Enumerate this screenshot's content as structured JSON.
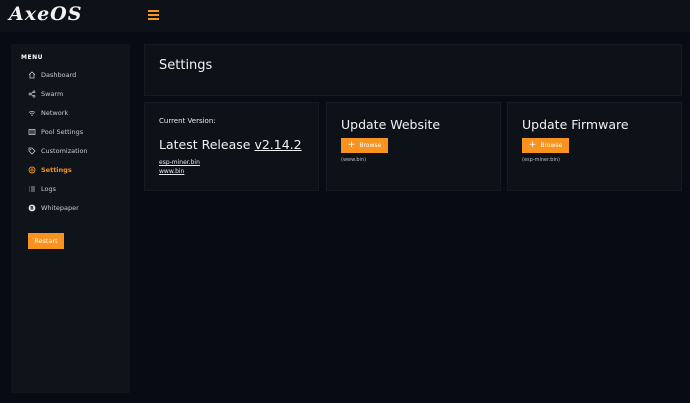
{
  "app": {
    "logo": "AxeOS"
  },
  "colors": {
    "accent": "#f7931e",
    "background": "#070b14",
    "panel": "#0d1219"
  },
  "sidebar": {
    "menu_title": "MENU",
    "items": [
      {
        "label": "Dashboard",
        "icon": "home-icon"
      },
      {
        "label": "Swarm",
        "icon": "share-icon"
      },
      {
        "label": "Network",
        "icon": "wifi-icon"
      },
      {
        "label": "Pool Settings",
        "icon": "server-icon"
      },
      {
        "label": "Customization",
        "icon": "tag-icon"
      },
      {
        "label": "Settings",
        "icon": "gear-icon",
        "active": true
      },
      {
        "label": "Logs",
        "icon": "list-icon"
      },
      {
        "label": "Whitepaper",
        "icon": "bitcoin-icon"
      }
    ],
    "restart_label": "Restart"
  },
  "main": {
    "settings_title": "Settings",
    "current_version_label": "Current Version:",
    "latest_release_prefix": "Latest Release",
    "latest_release_version": "v2.14.2",
    "release_links": [
      "esp-miner.bin",
      "www.bin"
    ],
    "update_website": {
      "title": "Update Website",
      "browse_label": "Browse",
      "hint": "(www.bin)"
    },
    "update_firmware": {
      "title": "Update Firmware",
      "browse_label": "Browse",
      "hint": "(esp-miner.bin)"
    }
  }
}
